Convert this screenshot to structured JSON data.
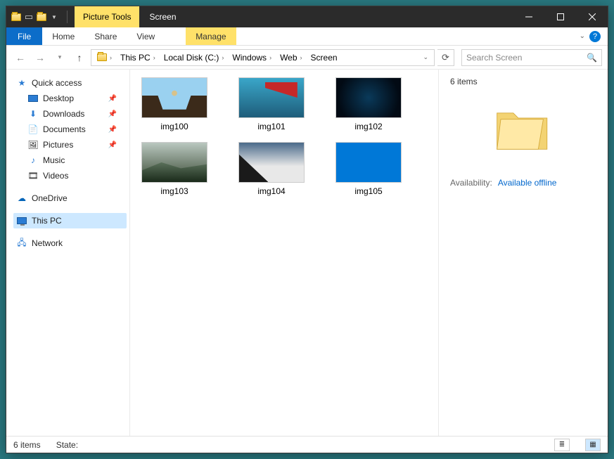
{
  "titlebar": {
    "contextual_tab": "Picture Tools",
    "window_title": "Screen"
  },
  "ribbon": {
    "file": "File",
    "tabs": [
      "Home",
      "Share",
      "View"
    ],
    "contextual": "Manage"
  },
  "address": {
    "segments": [
      "This PC",
      "Local Disk (C:)",
      "Windows",
      "Web",
      "Screen"
    ]
  },
  "search": {
    "placeholder": "Search Screen"
  },
  "nav": {
    "quick_access": "Quick access",
    "items": [
      {
        "label": "Desktop",
        "pinned": true
      },
      {
        "label": "Downloads",
        "pinned": true
      },
      {
        "label": "Documents",
        "pinned": true
      },
      {
        "label": "Pictures",
        "pinned": true
      },
      {
        "label": "Music",
        "pinned": false
      },
      {
        "label": "Videos",
        "pinned": false
      }
    ],
    "onedrive": "OneDrive",
    "this_pc": "This PC",
    "network": "Network"
  },
  "files": [
    {
      "name": "img100"
    },
    {
      "name": "img101"
    },
    {
      "name": "img102"
    },
    {
      "name": "img103"
    },
    {
      "name": "img104"
    },
    {
      "name": "img105"
    }
  ],
  "details": {
    "count": "6 items",
    "availability_label": "Availability:",
    "availability_value": "Available offline"
  },
  "status": {
    "count": "6 items",
    "state_label": "State:"
  }
}
